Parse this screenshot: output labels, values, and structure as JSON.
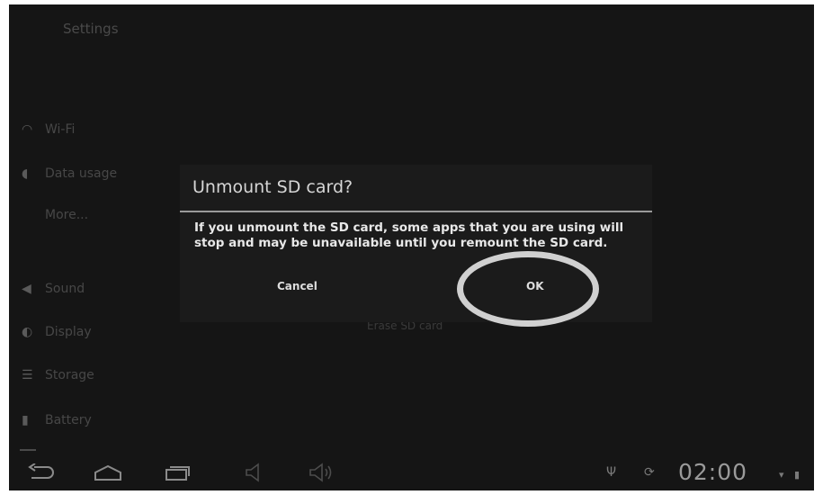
{
  "app": {
    "title": "Settings"
  },
  "settings_list": [
    {
      "icon": "wifi-icon",
      "label": "Wi-Fi"
    },
    {
      "icon": "data-usage-icon",
      "label": "Data usage"
    },
    {
      "icon": "",
      "label": "More..."
    },
    {
      "icon": "sound-icon",
      "label": "Sound"
    },
    {
      "icon": "display-icon",
      "label": "Display"
    },
    {
      "icon": "storage-icon",
      "label": "Storage"
    },
    {
      "icon": "battery-icon",
      "label": "Battery"
    }
  ],
  "background_button": {
    "label": "Erase SD card"
  },
  "dialog": {
    "title": "Unmount SD card?",
    "message": "If you unmount the SD card, some apps that you are using will stop and may be unavailable until you remount the SD card.",
    "cancel_label": "Cancel",
    "ok_label": "OK"
  },
  "navbar": {
    "buttons": [
      "back-icon",
      "home-icon",
      "recent-apps-icon",
      "volume-down-icon",
      "volume-up-icon"
    ]
  },
  "status_bar": {
    "clock": "02:00",
    "icons": [
      "usb-icon",
      "sync-icon",
      "wifi-signal-icon",
      "battery-status-icon"
    ]
  },
  "colors": {
    "background": "#151515",
    "dialog_background": "#1b1b1b",
    "highlight_ring": "#d0d0d0"
  }
}
